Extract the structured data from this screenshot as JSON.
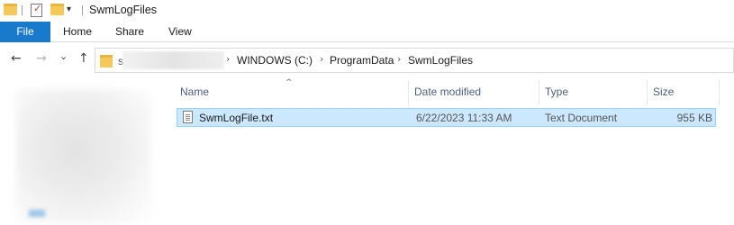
{
  "window": {
    "title": "SwmLogFiles"
  },
  "quick_access": {
    "dropdown_glyph": "▾"
  },
  "ribbon": {
    "tabs": [
      "File",
      "Home",
      "Share",
      "View"
    ]
  },
  "navigation": {
    "back_glyph": "←",
    "forward_glyph": "→",
    "recent_glyph": "⌄",
    "up_glyph": "↑",
    "address_prefix": "s",
    "breadcrumbs": [
      "WINDOWS (C:)",
      "ProgramData",
      "SwmLogFiles"
    ],
    "separator": "›"
  },
  "file_list": {
    "sort_indicator": "^",
    "columns": [
      "Name",
      "Date modified",
      "Type",
      "Size"
    ],
    "rows": [
      {
        "name": "SwmLogFile.txt",
        "date_modified": "6/22/2023 11:33 AM",
        "type": "Text Document",
        "size": "955 KB",
        "icon": "text-file-icon"
      }
    ]
  },
  "colors": {
    "file_tab_bg": "#1979ca",
    "selection_bg": "#cce8ff",
    "selection_border": "#99d1ff",
    "folder_yellow": "#f5c85a",
    "header_text": "#4c607a"
  }
}
